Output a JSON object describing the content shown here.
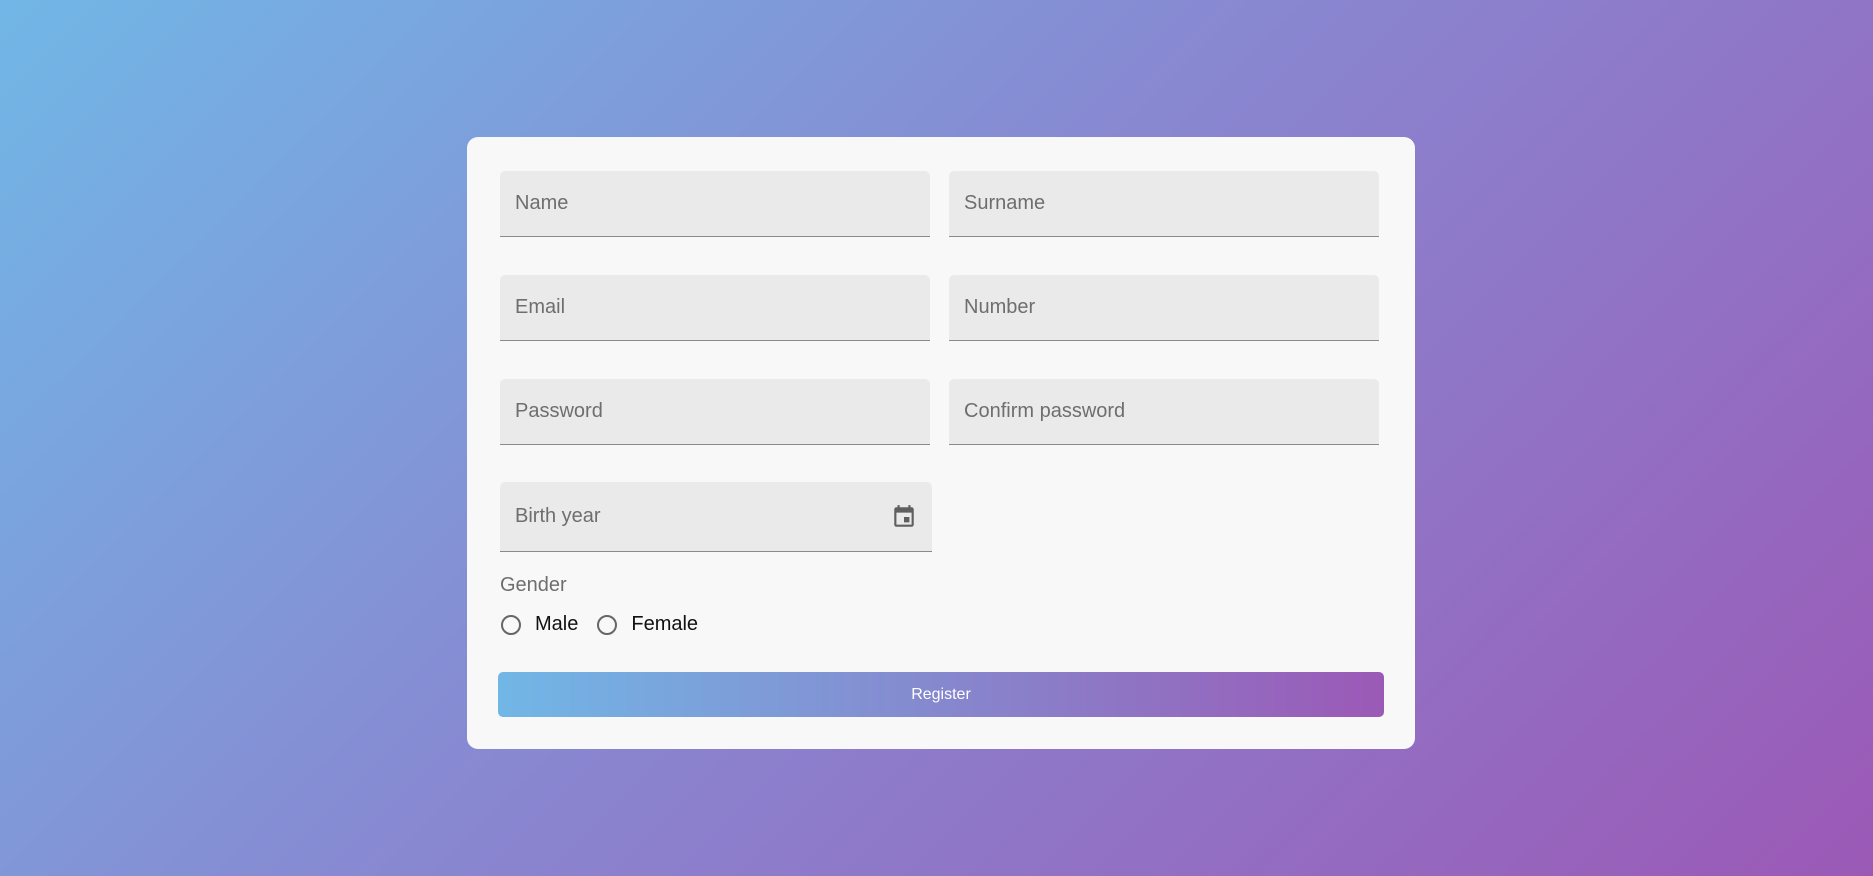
{
  "form": {
    "fields": {
      "name": {
        "placeholder": "Name",
        "value": ""
      },
      "surname": {
        "placeholder": "Surname",
        "value": ""
      },
      "email": {
        "placeholder": "Email",
        "value": ""
      },
      "number": {
        "placeholder": "Number",
        "value": ""
      },
      "password": {
        "placeholder": "Password",
        "value": ""
      },
      "confirm_password": {
        "placeholder": "Confirm password",
        "value": ""
      },
      "birth_year": {
        "placeholder": "Birth year",
        "value": "",
        "icon": "calendar-icon"
      }
    },
    "gender": {
      "label": "Gender",
      "options": [
        {
          "label": "Male",
          "selected": false
        },
        {
          "label": "Female",
          "selected": false
        }
      ]
    },
    "register_label": "Register"
  },
  "colors": {
    "gradient_start": "#71b7e6",
    "gradient_end": "#9b59b6",
    "card_background": "#f8f8f8",
    "field_background": "#eaeaea"
  }
}
